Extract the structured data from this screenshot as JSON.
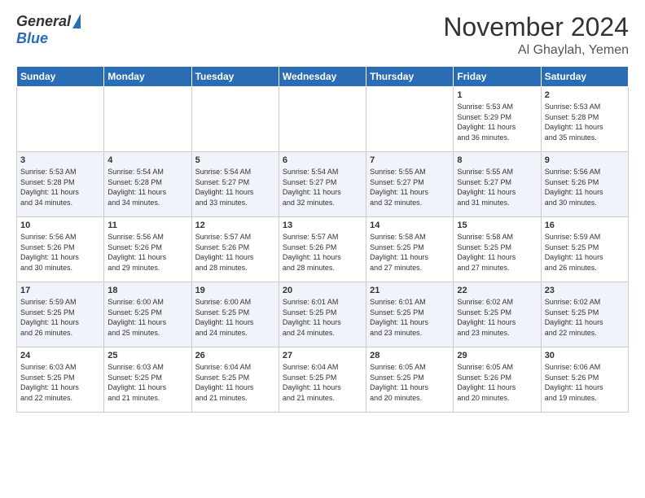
{
  "header": {
    "logo": {
      "general": "General",
      "blue": "Blue"
    },
    "title": "November 2024",
    "location": "Al Ghaylah, Yemen"
  },
  "weekdays": [
    "Sunday",
    "Monday",
    "Tuesday",
    "Wednesday",
    "Thursday",
    "Friday",
    "Saturday"
  ],
  "weeks": [
    [
      {
        "day": "",
        "info": ""
      },
      {
        "day": "",
        "info": ""
      },
      {
        "day": "",
        "info": ""
      },
      {
        "day": "",
        "info": ""
      },
      {
        "day": "",
        "info": ""
      },
      {
        "day": "1",
        "info": "Sunrise: 5:53 AM\nSunset: 5:29 PM\nDaylight: 11 hours\nand 36 minutes."
      },
      {
        "day": "2",
        "info": "Sunrise: 5:53 AM\nSunset: 5:28 PM\nDaylight: 11 hours\nand 35 minutes."
      }
    ],
    [
      {
        "day": "3",
        "info": "Sunrise: 5:53 AM\nSunset: 5:28 PM\nDaylight: 11 hours\nand 34 minutes."
      },
      {
        "day": "4",
        "info": "Sunrise: 5:54 AM\nSunset: 5:28 PM\nDaylight: 11 hours\nand 34 minutes."
      },
      {
        "day": "5",
        "info": "Sunrise: 5:54 AM\nSunset: 5:27 PM\nDaylight: 11 hours\nand 33 minutes."
      },
      {
        "day": "6",
        "info": "Sunrise: 5:54 AM\nSunset: 5:27 PM\nDaylight: 11 hours\nand 32 minutes."
      },
      {
        "day": "7",
        "info": "Sunrise: 5:55 AM\nSunset: 5:27 PM\nDaylight: 11 hours\nand 32 minutes."
      },
      {
        "day": "8",
        "info": "Sunrise: 5:55 AM\nSunset: 5:27 PM\nDaylight: 11 hours\nand 31 minutes."
      },
      {
        "day": "9",
        "info": "Sunrise: 5:56 AM\nSunset: 5:26 PM\nDaylight: 11 hours\nand 30 minutes."
      }
    ],
    [
      {
        "day": "10",
        "info": "Sunrise: 5:56 AM\nSunset: 5:26 PM\nDaylight: 11 hours\nand 30 minutes."
      },
      {
        "day": "11",
        "info": "Sunrise: 5:56 AM\nSunset: 5:26 PM\nDaylight: 11 hours\nand 29 minutes."
      },
      {
        "day": "12",
        "info": "Sunrise: 5:57 AM\nSunset: 5:26 PM\nDaylight: 11 hours\nand 28 minutes."
      },
      {
        "day": "13",
        "info": "Sunrise: 5:57 AM\nSunset: 5:26 PM\nDaylight: 11 hours\nand 28 minutes."
      },
      {
        "day": "14",
        "info": "Sunrise: 5:58 AM\nSunset: 5:25 PM\nDaylight: 11 hours\nand 27 minutes."
      },
      {
        "day": "15",
        "info": "Sunrise: 5:58 AM\nSunset: 5:25 PM\nDaylight: 11 hours\nand 27 minutes."
      },
      {
        "day": "16",
        "info": "Sunrise: 5:59 AM\nSunset: 5:25 PM\nDaylight: 11 hours\nand 26 minutes."
      }
    ],
    [
      {
        "day": "17",
        "info": "Sunrise: 5:59 AM\nSunset: 5:25 PM\nDaylight: 11 hours\nand 26 minutes."
      },
      {
        "day": "18",
        "info": "Sunrise: 6:00 AM\nSunset: 5:25 PM\nDaylight: 11 hours\nand 25 minutes."
      },
      {
        "day": "19",
        "info": "Sunrise: 6:00 AM\nSunset: 5:25 PM\nDaylight: 11 hours\nand 24 minutes."
      },
      {
        "day": "20",
        "info": "Sunrise: 6:01 AM\nSunset: 5:25 PM\nDaylight: 11 hours\nand 24 minutes."
      },
      {
        "day": "21",
        "info": "Sunrise: 6:01 AM\nSunset: 5:25 PM\nDaylight: 11 hours\nand 23 minutes."
      },
      {
        "day": "22",
        "info": "Sunrise: 6:02 AM\nSunset: 5:25 PM\nDaylight: 11 hours\nand 23 minutes."
      },
      {
        "day": "23",
        "info": "Sunrise: 6:02 AM\nSunset: 5:25 PM\nDaylight: 11 hours\nand 22 minutes."
      }
    ],
    [
      {
        "day": "24",
        "info": "Sunrise: 6:03 AM\nSunset: 5:25 PM\nDaylight: 11 hours\nand 22 minutes."
      },
      {
        "day": "25",
        "info": "Sunrise: 6:03 AM\nSunset: 5:25 PM\nDaylight: 11 hours\nand 21 minutes."
      },
      {
        "day": "26",
        "info": "Sunrise: 6:04 AM\nSunset: 5:25 PM\nDaylight: 11 hours\nand 21 minutes."
      },
      {
        "day": "27",
        "info": "Sunrise: 6:04 AM\nSunset: 5:25 PM\nDaylight: 11 hours\nand 21 minutes."
      },
      {
        "day": "28",
        "info": "Sunrise: 6:05 AM\nSunset: 5:25 PM\nDaylight: 11 hours\nand 20 minutes."
      },
      {
        "day": "29",
        "info": "Sunrise: 6:05 AM\nSunset: 5:26 PM\nDaylight: 11 hours\nand 20 minutes."
      },
      {
        "day": "30",
        "info": "Sunrise: 6:06 AM\nSunset: 5:26 PM\nDaylight: 11 hours\nand 19 minutes."
      }
    ]
  ]
}
